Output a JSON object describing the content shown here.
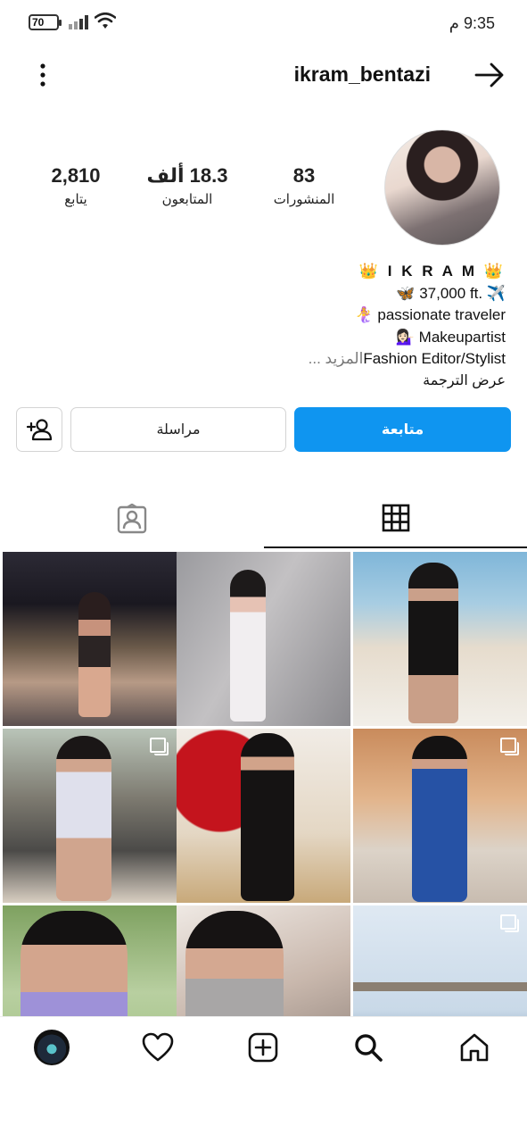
{
  "status_bar": {
    "battery": "70",
    "time": "9:35 م"
  },
  "header": {
    "username": "ikram_bentazi"
  },
  "stats": {
    "posts_count": "83",
    "posts_label": "المنشورات",
    "followers_count": "18.3 ألف",
    "followers_label": "المتابعون",
    "following_count": "2,810",
    "following_label": "يتابع"
  },
  "bio": {
    "name": "👑 I K R A M 👑",
    "line1": "🦋 37,000 ft. ✈️",
    "line2": "🧜‍♀️ passionate traveler",
    "line3": "💁🏻‍♀️ Makeupartist",
    "line4_text": "Fashion Editor/Stylist",
    "line4_more": "... المزيد",
    "translate": "عرض الترجمة"
  },
  "actions": {
    "follow": "متابعة",
    "message": "مراسلة"
  },
  "tabs": {
    "active": "grid",
    "items": [
      "grid",
      "tagged"
    ]
  },
  "grid_posts": [
    {
      "scene": "night city balcony",
      "multi": false
    },
    {
      "scene": "pink dress studio",
      "multi": false
    },
    {
      "scene": "beach black outfit",
      "multi": false
    },
    {
      "scene": "terrace lounge",
      "multi": true
    },
    {
      "scene": "heart wall red",
      "multi": false
    },
    {
      "scene": "blue leather dress",
      "multi": true
    },
    {
      "scene": "sunglasses garden",
      "multi": false
    },
    {
      "scene": "mirror selfie",
      "multi": false
    },
    {
      "scene": "sea bridge",
      "multi": true
    }
  ],
  "bottom_nav": {
    "items": [
      "home-icon",
      "search-icon",
      "add-post-icon",
      "heart-icon",
      "profile-avatar"
    ]
  },
  "colors": {
    "accent": "#0f95f0",
    "text": "#111111",
    "border": "#d4d4d4"
  }
}
